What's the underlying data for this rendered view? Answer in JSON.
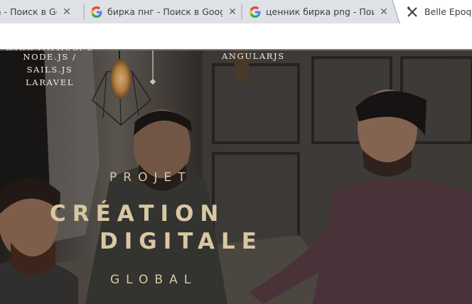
{
  "browser": {
    "tabs": [
      {
        "title": "а - Поиск в Google",
        "icon": "google-icon",
        "active": false
      },
      {
        "title": "бирка пнг - Поиск в Google",
        "icon": "google-icon",
        "active": false
      },
      {
        "title": "ценник бирка png - Поиск",
        "icon": "google-icon",
        "active": false
      },
      {
        "title": "Belle Epoque",
        "icon": "tools-icon",
        "active": true
      }
    ],
    "address_value": ""
  },
  "site": {
    "nav_left": [
      "WOOCOMMERCE",
      "NODE.JS / SAILS.JS",
      "LARAVEL"
    ],
    "nav_right": [
      "ANGULARJS"
    ],
    "logo": {
      "top": "PROJET",
      "line1": "CRÉATION",
      "line2": "DIGITALE",
      "bottom": "GLOBAL"
    }
  },
  "colors": {
    "tabstrip": "#dee1e6",
    "logo": "#d9c7a4",
    "nav_text": "#f2ede4",
    "photo_dark": "#2a2522"
  }
}
